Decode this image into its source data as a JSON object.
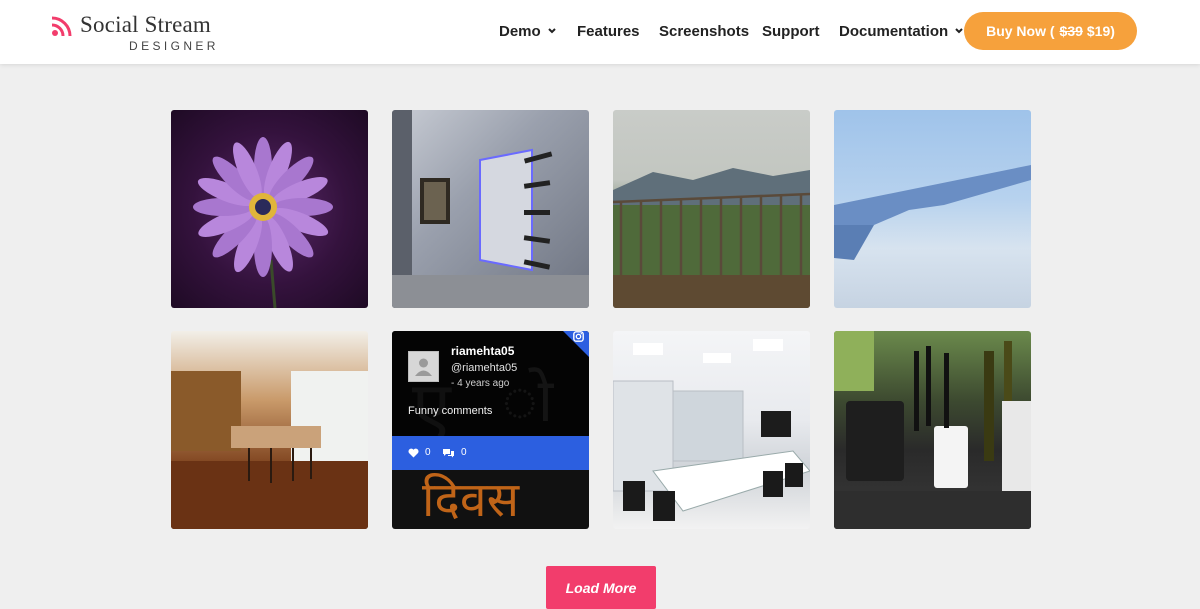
{
  "brand": {
    "title": "Social Stream",
    "subtitle": "DESIGNER",
    "accent": "#f23d6c"
  },
  "nav": {
    "items": [
      {
        "label": "Demo",
        "has_dropdown": true
      },
      {
        "label": "Features",
        "has_dropdown": false
      },
      {
        "label": "Screenshots",
        "has_dropdown": false
      },
      {
        "label": "Support",
        "has_dropdown": false
      },
      {
        "label": "Documentation",
        "has_dropdown": true
      }
    ],
    "buy": {
      "prefix": "Buy Now (",
      "old_price": "$39",
      "new_price": "$19)",
      "color": "#f6a13c"
    }
  },
  "grid": {
    "tiles": [
      {
        "subject": "purple daisy flower"
      },
      {
        "subject": "modern ceiling interior"
      },
      {
        "subject": "mountain view with railing"
      },
      {
        "subject": "airplane wing above clouds"
      },
      {
        "subject": "wooden kitchen interior"
      },
      {
        "subject": "instagram post"
      },
      {
        "subject": "conference room"
      },
      {
        "subject": "kitchen jars and bottles"
      }
    ],
    "featured_post": {
      "username": "riamehta05",
      "handle": "@riamehta05",
      "time": "- 4 years ago",
      "text": "Funny comments",
      "likes": "0",
      "comments": "0",
      "network_icon": "instagram-icon",
      "bar_color": "#2c5fe0"
    }
  },
  "load_more": {
    "label": "Load More"
  }
}
